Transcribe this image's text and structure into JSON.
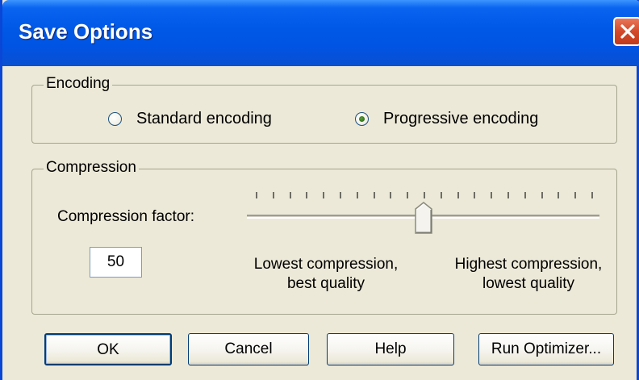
{
  "window": {
    "title": "Save Options"
  },
  "encoding": {
    "legend": "Encoding",
    "options": [
      {
        "label": "Standard encoding",
        "selected": false
      },
      {
        "label": "Progressive encoding",
        "selected": true
      }
    ]
  },
  "compression": {
    "legend": "Compression",
    "factor_label": "Compression factor:",
    "factor_value": "50",
    "slider_level_percent": 50,
    "low_label_line1": "Lowest compression,",
    "low_label_line2": "best quality",
    "high_label_line1": "Highest compression,",
    "high_label_line2": "lowest quality"
  },
  "buttons": {
    "ok": "OK",
    "cancel": "Cancel",
    "help": "Help",
    "optimizer": "Run Optimizer..."
  },
  "icons": {
    "close": "close-icon",
    "slider_thumb": "slider-thumb-icon"
  },
  "colors": {
    "titlebar": "#0054e3",
    "close_button": "#d34a2a",
    "dialog_background": "#ece9d8"
  }
}
